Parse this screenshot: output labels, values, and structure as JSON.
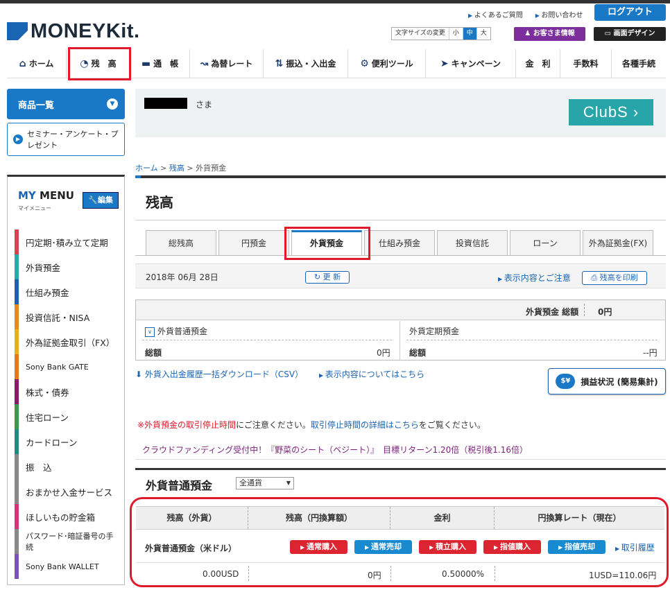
{
  "header": {
    "logo": "MONEYKit.",
    "links": [
      "よくあるご質問",
      "お問い合わせ"
    ],
    "logout": "ログアウト",
    "font_size_label": "文字サイズの変更",
    "font_sizes": [
      "小",
      "中",
      "大"
    ],
    "customer_info": "お客さま情報",
    "screen_design": "画面デザイン"
  },
  "nav": [
    {
      "label": "ホーム",
      "icon": "home-icon"
    },
    {
      "label": "残　高",
      "icon": "pie-chart-icon"
    },
    {
      "label": "通　帳",
      "icon": "passbook-icon"
    },
    {
      "label": "為替レート",
      "icon": "exchange-rate-icon"
    },
    {
      "label": "振込・入出金",
      "icon": "transfer-icon"
    },
    {
      "label": "便利ツール",
      "icon": "gear-icon"
    },
    {
      "label": "キャンペーン",
      "icon": "megaphone-icon"
    },
    {
      "label": "金　利",
      "icon": ""
    },
    {
      "label": "手数料",
      "icon": ""
    },
    {
      "label": "各種手続",
      "icon": ""
    }
  ],
  "sidebar": {
    "products": "商品一覧",
    "seminar": "セミナー・アンケート・プレゼント",
    "mymenu_title_a": "MY",
    "mymenu_title_b": " MENU",
    "mymenu_sub": "マイメニュー",
    "edit": "編集",
    "items": [
      {
        "label": "円定期･積み立て定期",
        "color": "#d9434f"
      },
      {
        "label": "外貨預金",
        "color": "#27a9b0"
      },
      {
        "label": "仕組み預金",
        "color": "#1c5fae"
      },
      {
        "label": "投資信託・NISA",
        "color": "#e58a1f"
      },
      {
        "label": "外為証拠金取引（FX）",
        "color": "#e8b11c"
      },
      {
        "label": "Sony Bank GATE",
        "color": "#e5781b"
      },
      {
        "label": "株式・債券",
        "color": "#8c1a6a"
      },
      {
        "label": "住宅ローン",
        "color": "#3a9a4a"
      },
      {
        "label": "カードローン",
        "color": "#1f8a7f"
      },
      {
        "label": "振　込",
        "color": "#888888"
      },
      {
        "label": "おまかせ入金サービス",
        "color": "#888888"
      },
      {
        "label": "ほしいもの貯金箱",
        "color": "#d6337a"
      },
      {
        "label": "パスワード･暗証番号の手続",
        "color": "#888888"
      },
      {
        "label": "Sony Bank WALLET",
        "color": "#7b52b8"
      }
    ]
  },
  "greeting": {
    "suffix": "さま",
    "banner": "ClubS"
  },
  "breadcrumb": {
    "home": "ホーム",
    "balance": "残高",
    "current": "外貨預金",
    "sep": ">"
  },
  "page_title": "残高",
  "tabs": [
    "総残高",
    "円預金",
    "外貨預金",
    "仕組み預金",
    "投資信託",
    "ローン",
    "外為証拠金(FX)"
  ],
  "date_bar": {
    "date": "2018年 06月 28日",
    "refresh": "更 新",
    "notice": "表示内容とご注意",
    "print": "残高を印刷"
  },
  "summary": {
    "total_label": "外貨預金 総額",
    "total_value": "0円",
    "left_title": "外貨普通預金",
    "right_title": "外貨定期預金",
    "left_total_label": "総額",
    "left_total_value": "0円",
    "right_total_label": "総額",
    "right_total_value": "--円"
  },
  "links": {
    "csv": "外貨入出金履歴一括ダウンロード（CSV）",
    "about": "表示内容についてはこちら",
    "pl": "損益状況 (簡易集計)"
  },
  "warning": {
    "red": "※外貨預金の取引停止時間",
    "t1": "にご注意ください。",
    "link": "取引停止時間の詳細はこちら",
    "t2": "をご覧ください。"
  },
  "fund_notice": "クラウドファンディング受付中！『野菜のシート（ベジート）』　目標リターン1.20倍（税引後1.16倍）",
  "section": {
    "title": "外貨普通預金",
    "currency_select": "全通貨",
    "headers": [
      "残高（外貨）",
      "残高（円換算額）",
      "金利",
      "円換算レート（現在）"
    ],
    "account": "外貨普通預金（米ドル）",
    "buttons": {
      "normal_buy": "通常購入",
      "normal_sell": "通常売却",
      "accum_buy": "積立購入",
      "limit_buy": "指値購入",
      "limit_sell": "指値売却"
    },
    "history": "取引履歴",
    "values": {
      "fx_balance": "0.00USD",
      "jpy_balance": "0円",
      "rate": "0.50000%",
      "fx_rate": "1USD=110.06円"
    }
  }
}
